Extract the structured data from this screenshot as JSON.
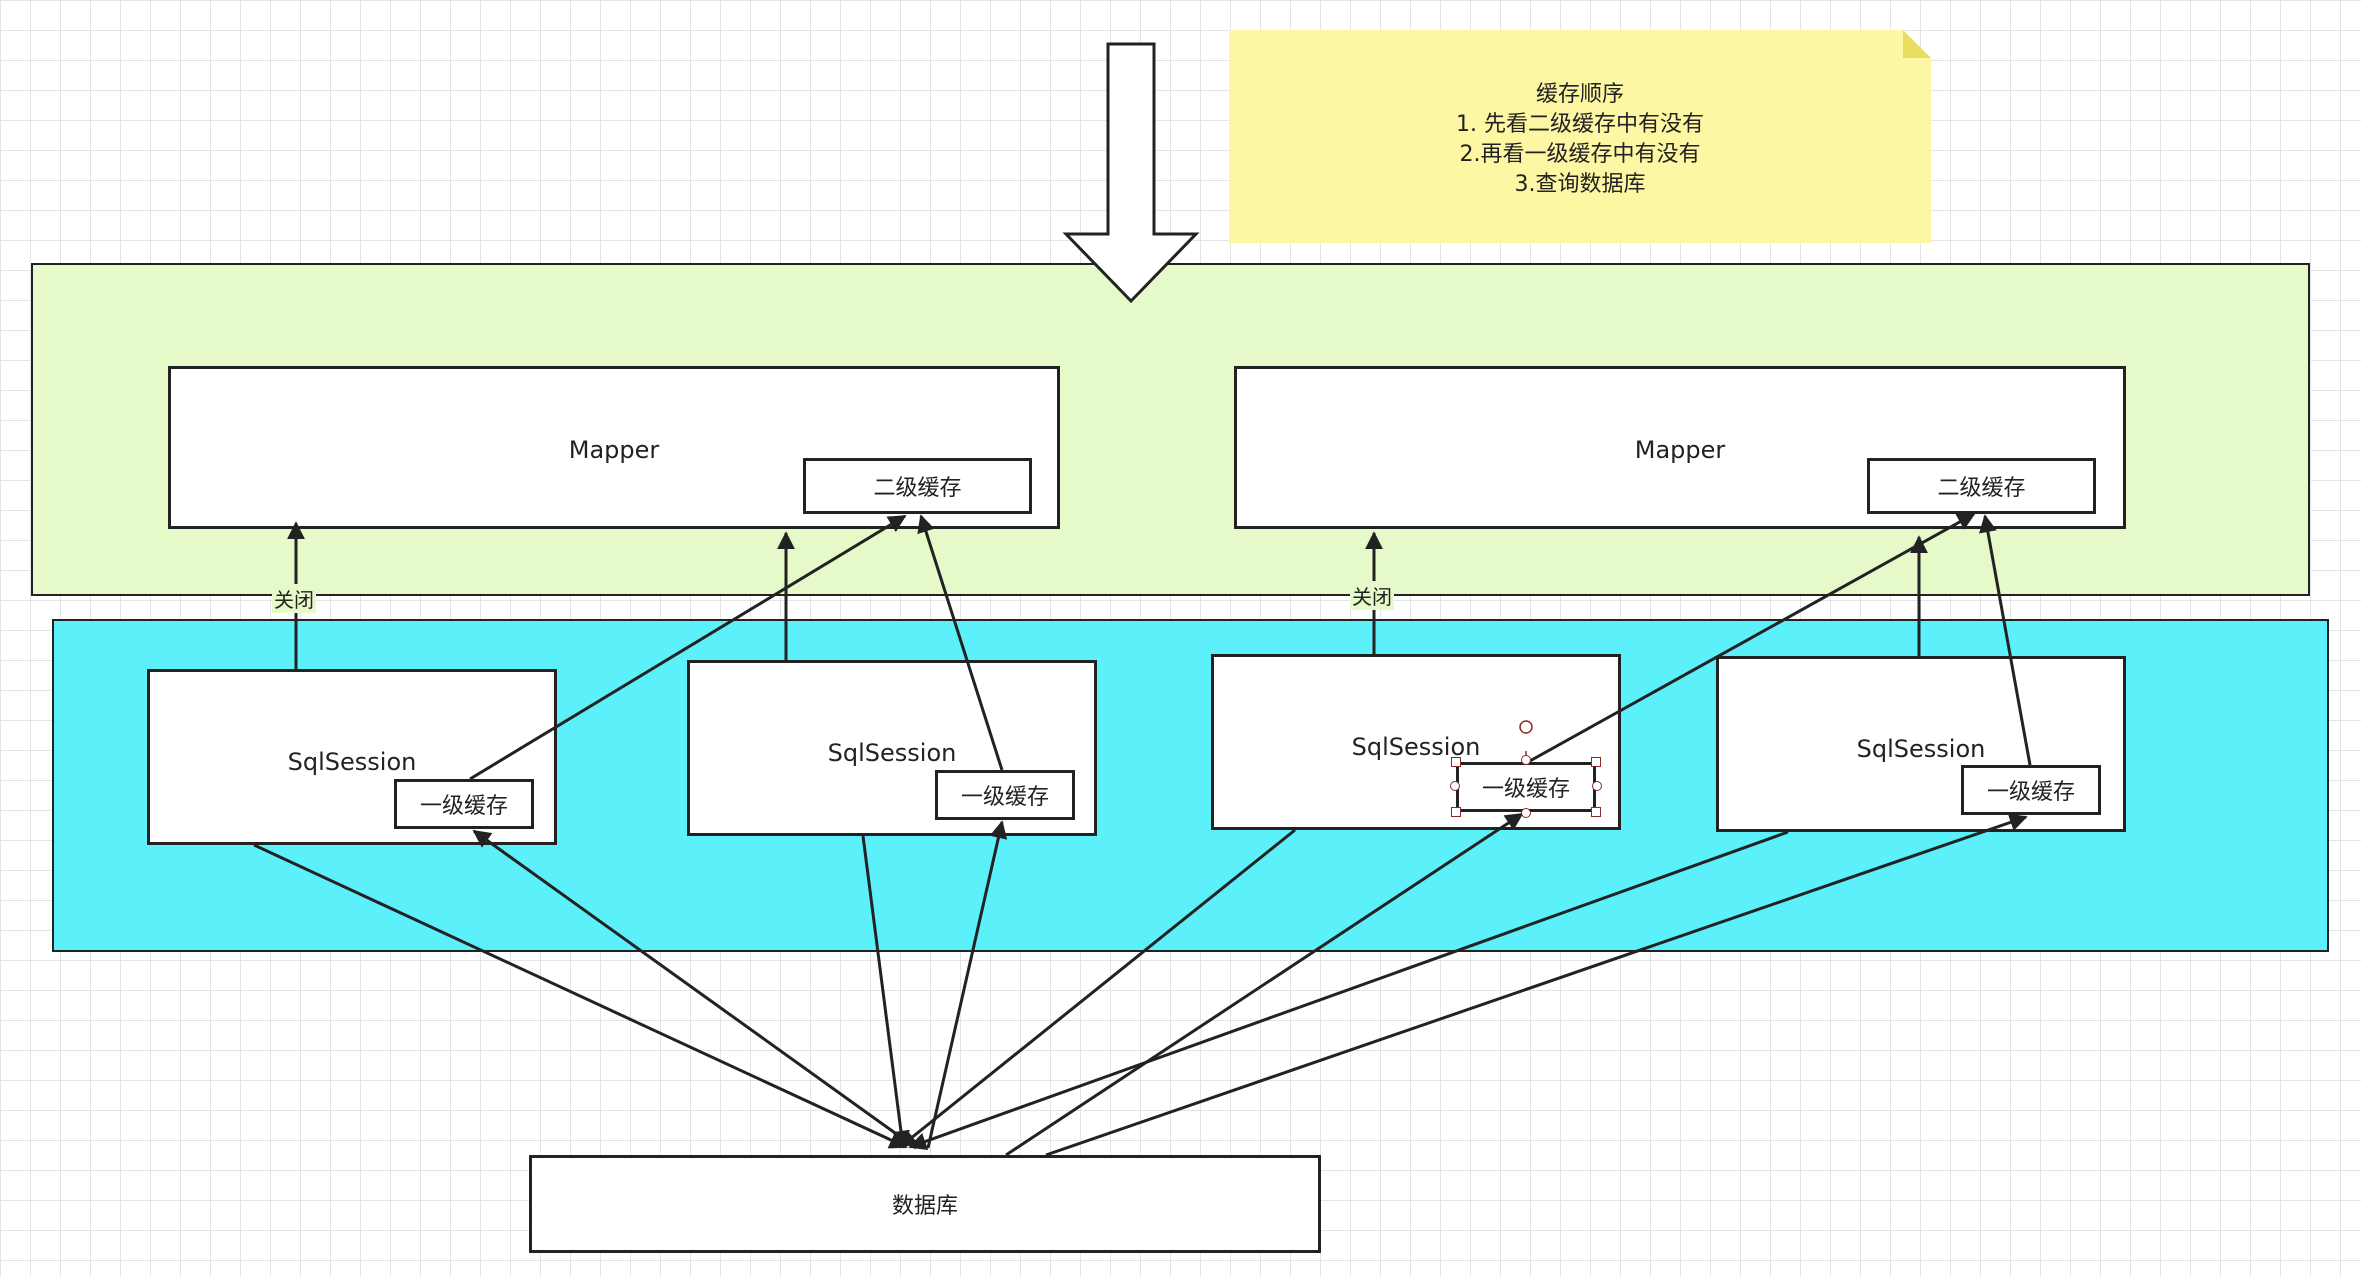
{
  "note": {
    "lines": [
      "缓存顺序",
      "1. 先看二级缓存中有没有",
      "2.再看一级缓存中有没有",
      "3.查询数据库"
    ]
  },
  "mappers": [
    {
      "label": "Mapper",
      "cache_label": "二级缓存"
    },
    {
      "label": "Mapper",
      "cache_label": "二级缓存"
    }
  ],
  "sessions": [
    {
      "label": "SqlSession",
      "cache_label": "一级缓存"
    },
    {
      "label": "SqlSession",
      "cache_label": "一级缓存"
    },
    {
      "label": "SqlSession",
      "cache_label": "一级缓存"
    },
    {
      "label": "SqlSession",
      "cache_label": "一级缓存"
    }
  ],
  "edge_labels": [
    "关闭",
    "关闭"
  ],
  "database": {
    "label": "数据库"
  },
  "colors": {
    "mapper_region": "#e6f9c8",
    "session_region": "#5cf0fa",
    "note": "#fdf6a2",
    "stroke": "#222222"
  }
}
